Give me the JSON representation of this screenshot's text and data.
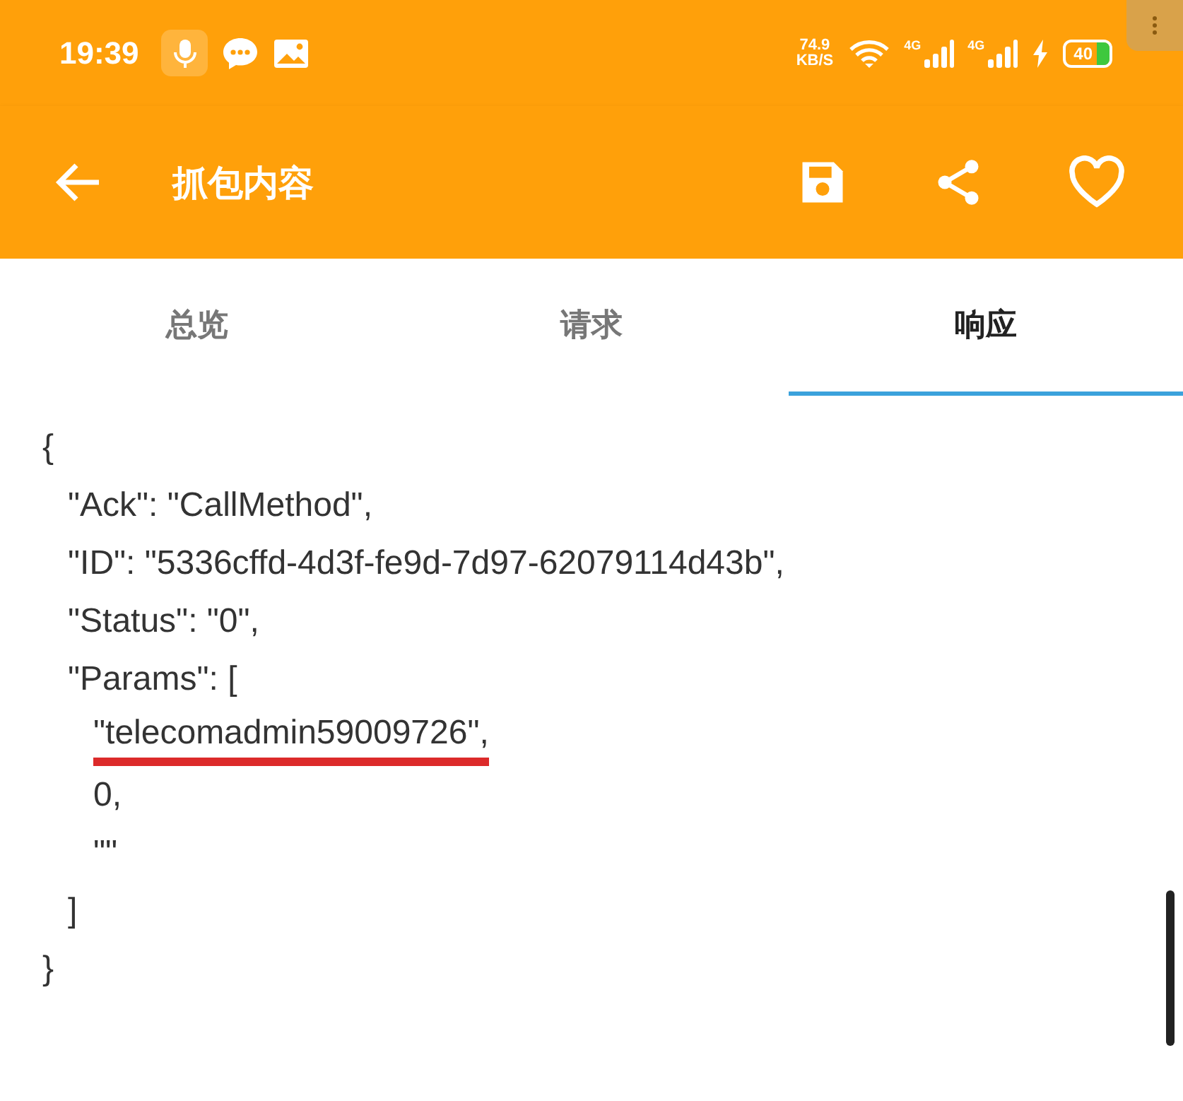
{
  "status_bar": {
    "time": "19:39",
    "speed_value": "74.9",
    "speed_unit": "KB/S",
    "network_labels": [
      "4G",
      "4G"
    ],
    "battery": "40"
  },
  "app_bar": {
    "title": "抓包内容"
  },
  "tabs": [
    {
      "label": "总览",
      "selected": false
    },
    {
      "label": "请求",
      "selected": false
    },
    {
      "label": "响应",
      "selected": true
    }
  ],
  "code_lines": [
    {
      "text": "{",
      "children": [
        {
          "text": "\"Ack\": \"CallMethod\","
        },
        {
          "text": "\"ID\": \"5336cffd-4d3f-fe9d-7d97-62079114d43b\","
        },
        {
          "text": "\"Status\": \"0\","
        },
        {
          "text": "\"Params\": [",
          "children": [
            {
              "text": "\"telecomadmin59009726\",",
              "underlined": true
            },
            {
              "text": "0,",
              "underlined": false
            },
            {
              "text": "\"\"",
              "underlined": false
            }
          ]
        },
        {
          "text": "]"
        }
      ]
    },
    {
      "text": "}"
    }
  ]
}
